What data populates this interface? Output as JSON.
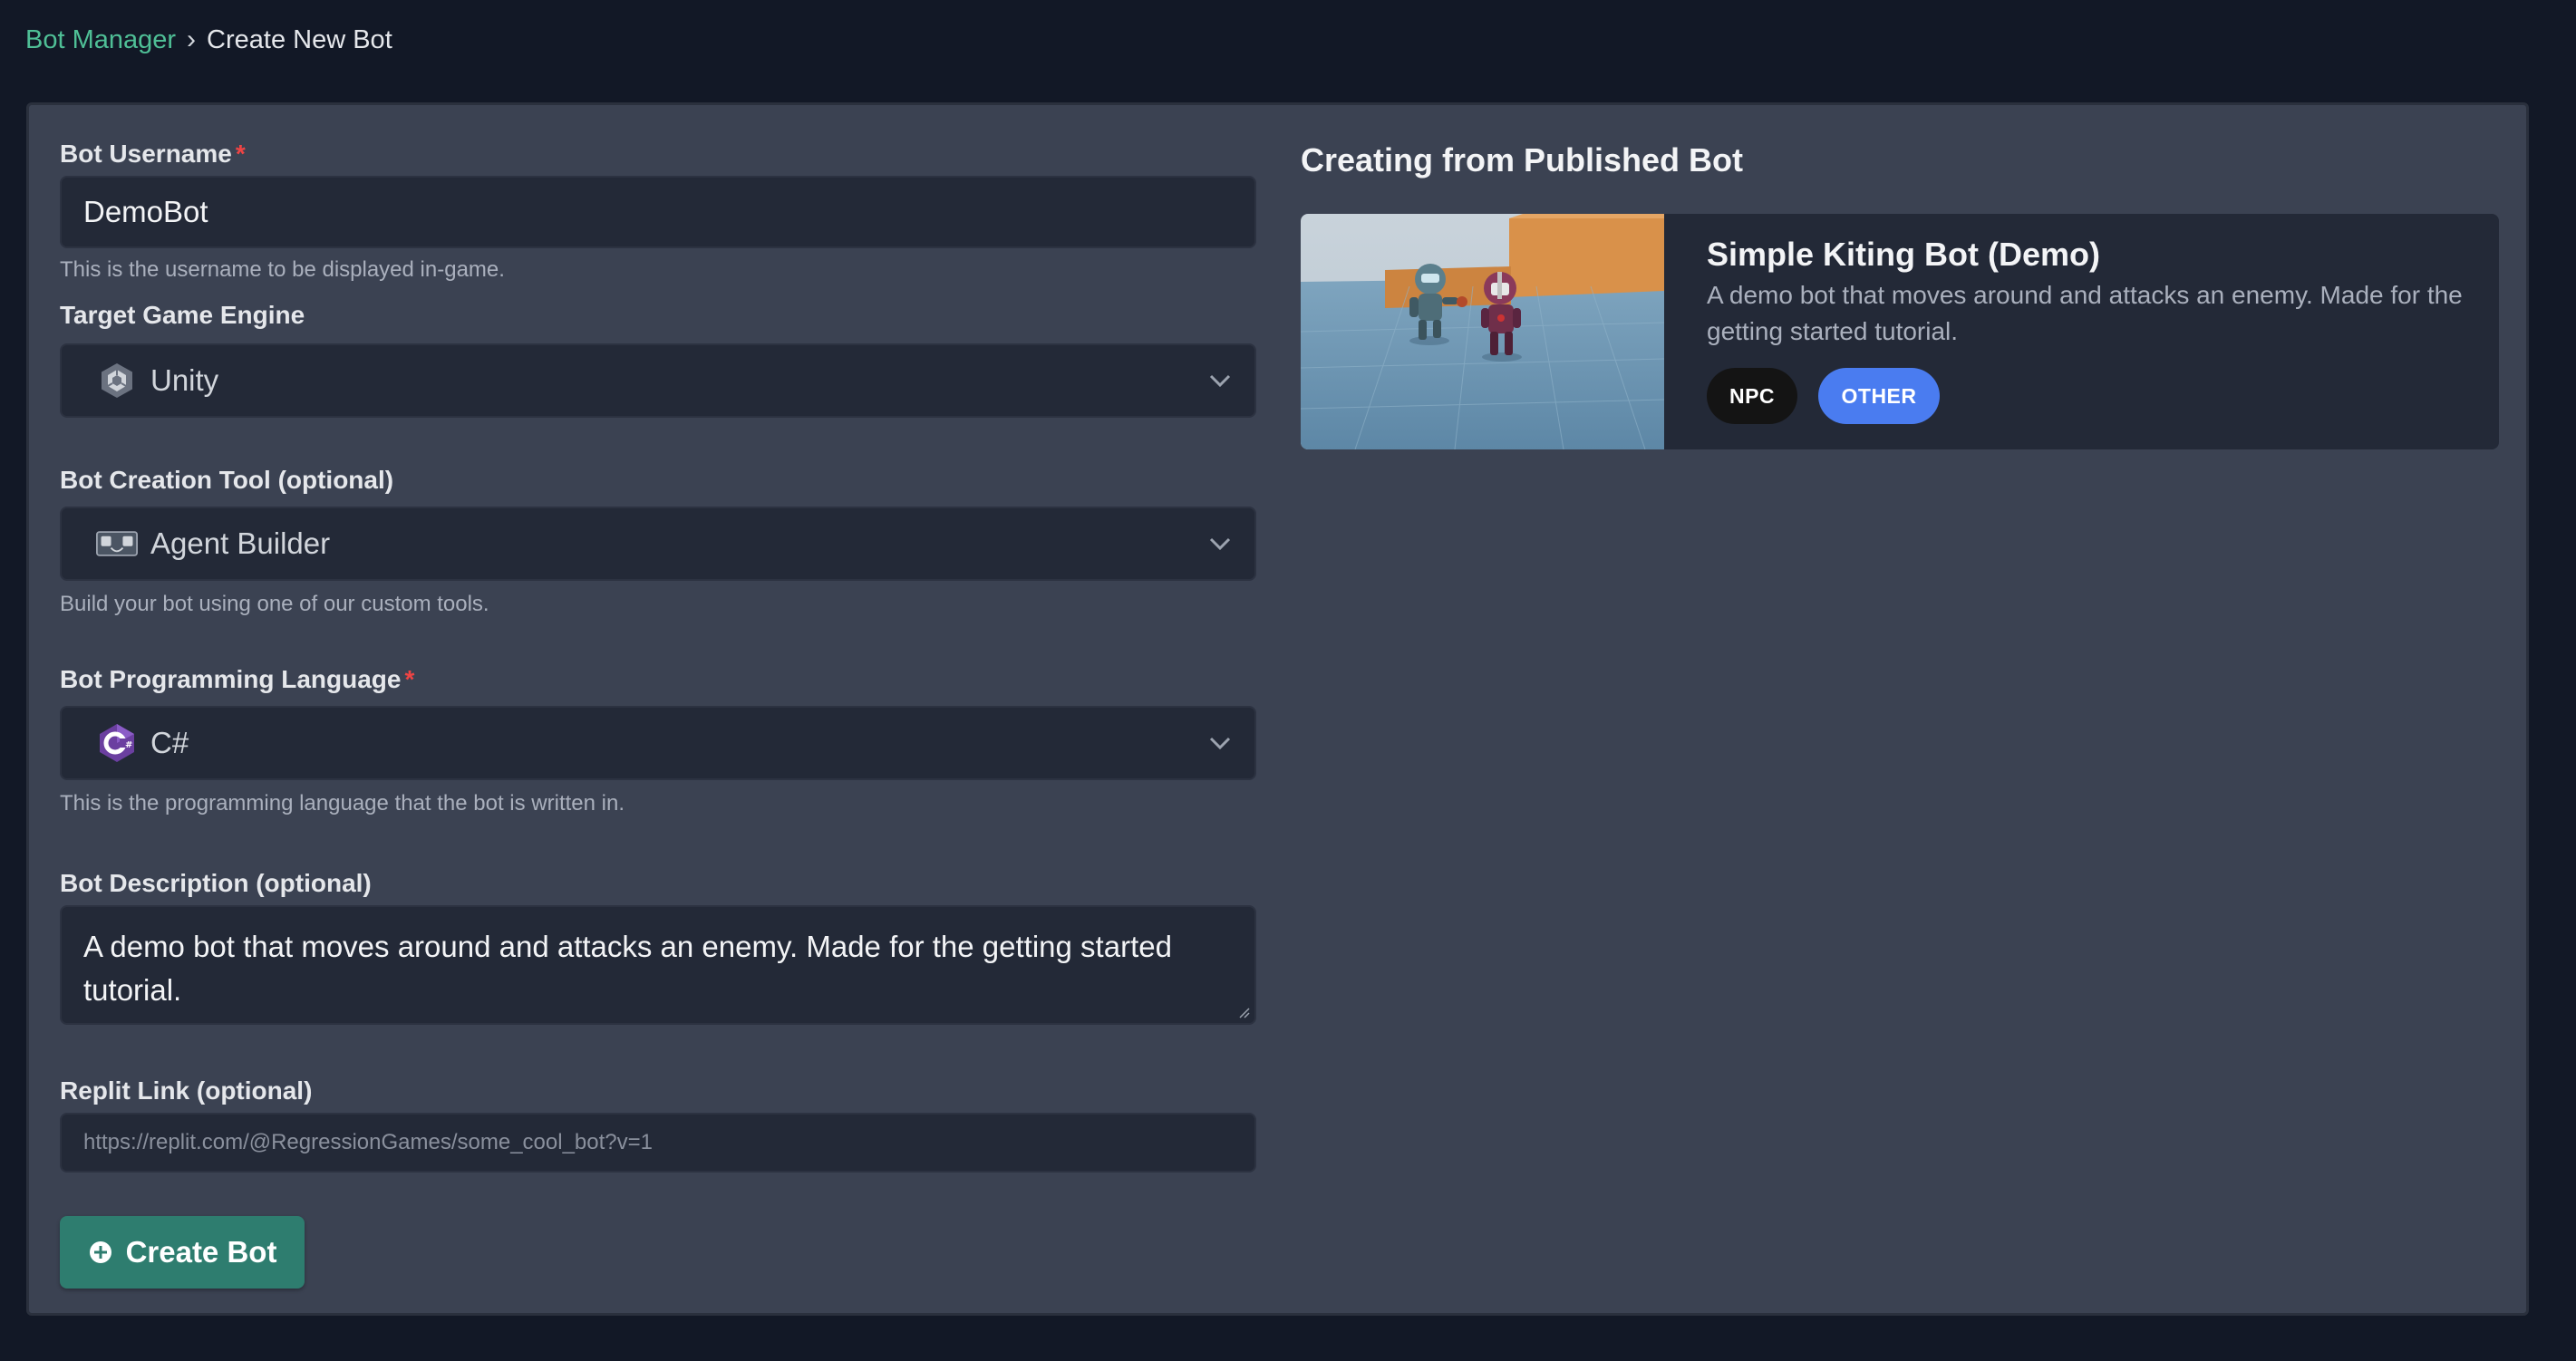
{
  "breadcrumb": {
    "parent": "Bot Manager",
    "separator": "›",
    "current": "Create New Bot"
  },
  "form": {
    "username": {
      "label": "Bot Username",
      "required_mark": "*",
      "value": "DemoBot",
      "hint": "This is the username to be displayed in-game."
    },
    "engine": {
      "label": "Target Game Engine",
      "value": "Unity",
      "icon": "unity-icon"
    },
    "tool": {
      "label": "Bot Creation Tool (optional)",
      "value": "Agent Builder",
      "icon": "agent-builder-icon",
      "hint": "Build your bot using one of our custom tools."
    },
    "language": {
      "label": "Bot Programming Language",
      "required_mark": "*",
      "value": "C#",
      "icon": "csharp-icon",
      "hint": "This is the programming language that the bot is written in."
    },
    "description": {
      "label": "Bot Description (optional)",
      "value": "A demo bot that moves around and attacks an enemy. Made for the getting started tutorial."
    },
    "replit": {
      "label": "Replit Link (optional)",
      "placeholder": "https://replit.com/@RegressionGames/some_cool_bot?v=1",
      "value": ""
    },
    "submit_label": "Create Bot"
  },
  "source": {
    "title": "Creating from Published Bot",
    "bot_name": "Simple Kiting Bot (Demo)",
    "bot_description": "A demo bot that moves around and attacks an enemy. Made for the getting started tutorial.",
    "tags": [
      "NPC",
      "OTHER"
    ]
  },
  "colors": {
    "background": "#121826",
    "panel": "#3b4252",
    "field": "#232937",
    "accent_green": "#4fbf96",
    "button": "#2e7d6f",
    "tag_other": "#4a7cf0",
    "required": "#ef4444"
  }
}
